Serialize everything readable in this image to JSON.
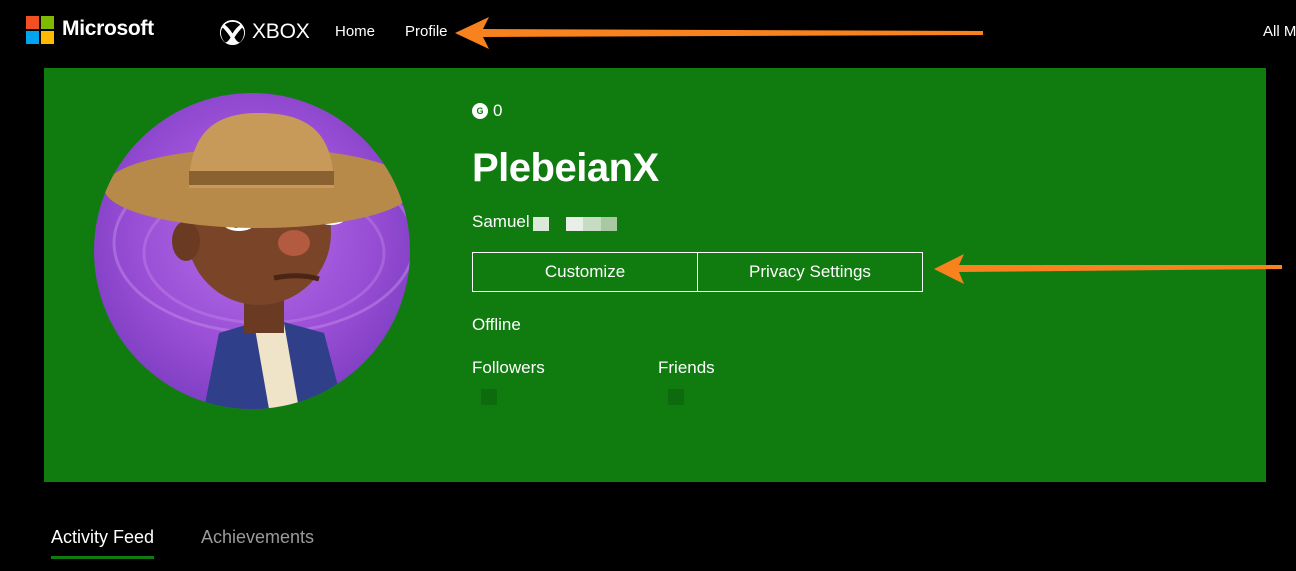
{
  "header": {
    "brand": "Microsoft",
    "xbox_word": "XBOX",
    "nav": [
      {
        "label": "Home"
      },
      {
        "label": "Profile"
      }
    ],
    "right_link": "All M",
    "ms_logo_colors": [
      "#f25022",
      "#7fba00",
      "#00a4ef",
      "#ffb900"
    ]
  },
  "profile": {
    "gamerscore_badge": "G",
    "gamerscore": "0",
    "gamertag": "PlebeianX",
    "real_name": "Samuel",
    "buttons": {
      "customize": "Customize",
      "privacy": "Privacy Settings"
    },
    "status": "Offline",
    "followers_label": "Followers",
    "friends_label": "Friends",
    "banner_color": "#107c10"
  },
  "tabs": [
    {
      "label": "Activity Feed",
      "active": true
    },
    {
      "label": "Achievements",
      "active": false
    }
  ],
  "annotations": {
    "arrow_color": "#f7821e"
  }
}
